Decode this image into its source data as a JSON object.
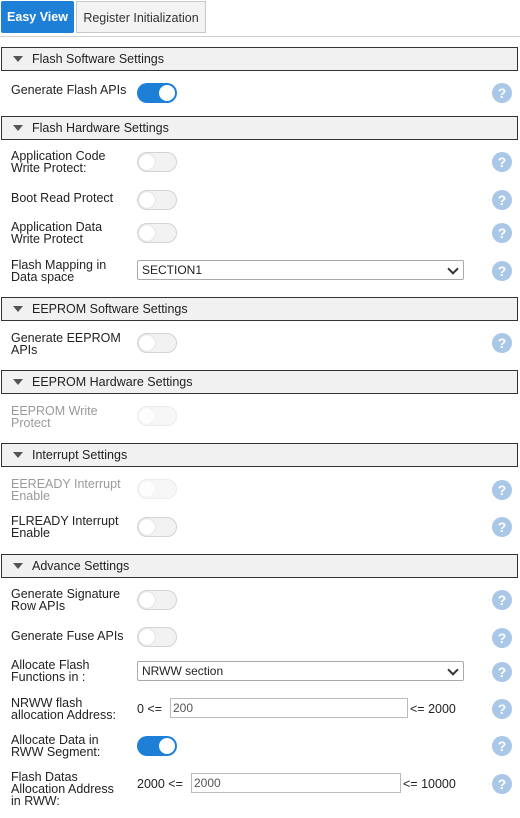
{
  "tabs": {
    "easy_view": "Easy View",
    "register_init": "Register Initialization"
  },
  "colors": {
    "accent": "#1e7fd6",
    "help_icon": "#a9c7e6"
  },
  "sections": {
    "flash_software": "Flash Software Settings",
    "flash_hardware": "Flash Hardware Settings",
    "eeprom_software": "EEPROM Software Settings",
    "eeprom_hardware": "EEPROM Hardware Settings",
    "interrupt": "Interrupt Settings",
    "advance": "Advance Settings"
  },
  "fields": {
    "generate_flash_apis": {
      "label": [
        "Generate Flash APIs"
      ],
      "value": true
    },
    "app_code_write_protect": {
      "label": [
        "Application Code",
        "Write Protect:"
      ],
      "value": false
    },
    "boot_read_protect": {
      "label": [
        "Boot Read Protect"
      ],
      "value": false
    },
    "app_data_write_protect": {
      "label": [
        "Application Data",
        "Write Protect"
      ],
      "value": false
    },
    "flash_mapping": {
      "label": [
        "Flash Mapping in",
        "Data space"
      ],
      "selected": "SECTION1"
    },
    "generate_eeprom_apis": {
      "label": [
        "Generate EEPROM",
        "APIs"
      ],
      "value": false
    },
    "eeprom_write_protect": {
      "label": [
        "EEPROM Write",
        "Protect"
      ],
      "value": false,
      "disabled": true
    },
    "eeready_interrupt": {
      "label": [
        "EEREADY Interrupt",
        "Enable"
      ],
      "value": false,
      "disabled": true
    },
    "flready_interrupt": {
      "label": [
        "FLREADY Interrupt",
        "Enable"
      ],
      "value": false
    },
    "generate_signature_row": {
      "label": [
        "Generate Signature",
        "Row APIs"
      ],
      "value": false
    },
    "generate_fuse_apis": {
      "label": [
        "Generate Fuse APIs"
      ],
      "value": false
    },
    "allocate_flash_functions": {
      "label": [
        "Allocate Flash",
        "Functions in :"
      ],
      "selected": "NRWW section"
    },
    "nrww_alloc_address": {
      "label": [
        "NRWW flash",
        "allocation Address:"
      ],
      "min_text": "0 <=",
      "value": "200",
      "max_text": "<= 2000"
    },
    "allocate_data_rww": {
      "label": [
        "Allocate Data in",
        "RWW Segment:"
      ],
      "value": true
    },
    "flash_datas_alloc_address": {
      "label": [
        "Flash Datas",
        "Allocation Address",
        "in RWW:"
      ],
      "min_text": "2000 <=",
      "value": "2000",
      "max_text": "<= 10000"
    }
  },
  "help_symbol": "?"
}
